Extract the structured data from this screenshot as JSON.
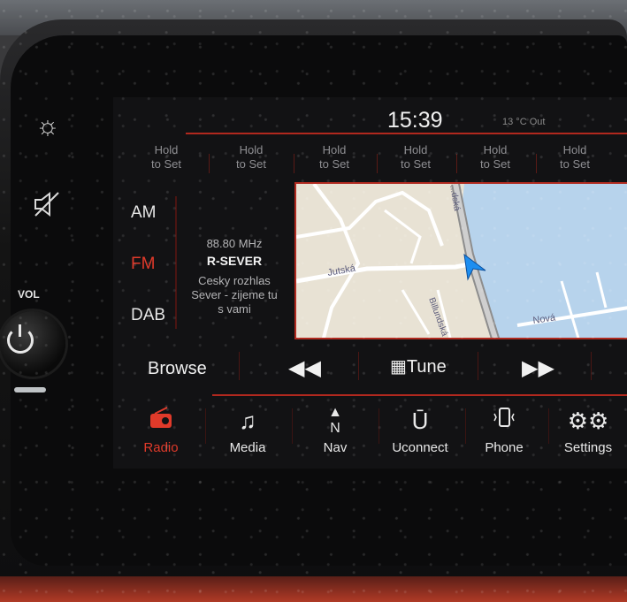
{
  "status": {
    "time": "15:39",
    "temperature": "13 °C Out"
  },
  "presets": [
    {
      "line1": "Hold",
      "line2": "to Set"
    },
    {
      "line1": "Hold",
      "line2": "to Set"
    },
    {
      "line1": "Hold",
      "line2": "to Set"
    },
    {
      "line1": "Hold",
      "line2": "to Set"
    },
    {
      "line1": "Hold",
      "line2": "to Set"
    },
    {
      "line1": "Hold",
      "line2": "to Set"
    }
  ],
  "bands": [
    {
      "label": "AM",
      "active": false
    },
    {
      "label": "FM",
      "active": true
    },
    {
      "label": "DAB",
      "active": false
    }
  ],
  "station": {
    "frequency": "88.80 MHz",
    "name": "R-SEVER",
    "text_line1": "Cesky rozhlas",
    "text_line2": "Sever - zijeme tu",
    "text_line3": "s vami"
  },
  "map": {
    "streets": [
      "Jutská",
      "Billundská",
      "Nová",
      "...dská"
    ],
    "position_icon": "navigation-arrow-icon"
  },
  "controls": {
    "browse_label": "Browse",
    "prev_icon": "rewind-icon",
    "tune_label": "Tune",
    "tune_icon": "grid-icon",
    "next_icon": "fast-forward-icon"
  },
  "hardware": {
    "vol_label": "VOL",
    "brightness_icon": "sun-icon",
    "mute_icon": "speaker-mute-icon",
    "power_icon": "power-icon"
  },
  "nav": [
    {
      "label": "Radio",
      "icon": "radio-icon",
      "active": true
    },
    {
      "label": "Media",
      "icon": "music-note-icon",
      "active": false
    },
    {
      "label": "Nav",
      "icon": "north-arrow-icon",
      "active": false
    },
    {
      "label": "Uconnect",
      "icon": "uconnect-icon",
      "active": false
    },
    {
      "label": "Phone",
      "icon": "phone-icon",
      "active": false
    },
    {
      "label": "Settings",
      "icon": "gears-icon",
      "active": false
    }
  ],
  "colors": {
    "accent": "#e03a2a",
    "line": "#b1281e",
    "text": "#f0f0f0"
  }
}
